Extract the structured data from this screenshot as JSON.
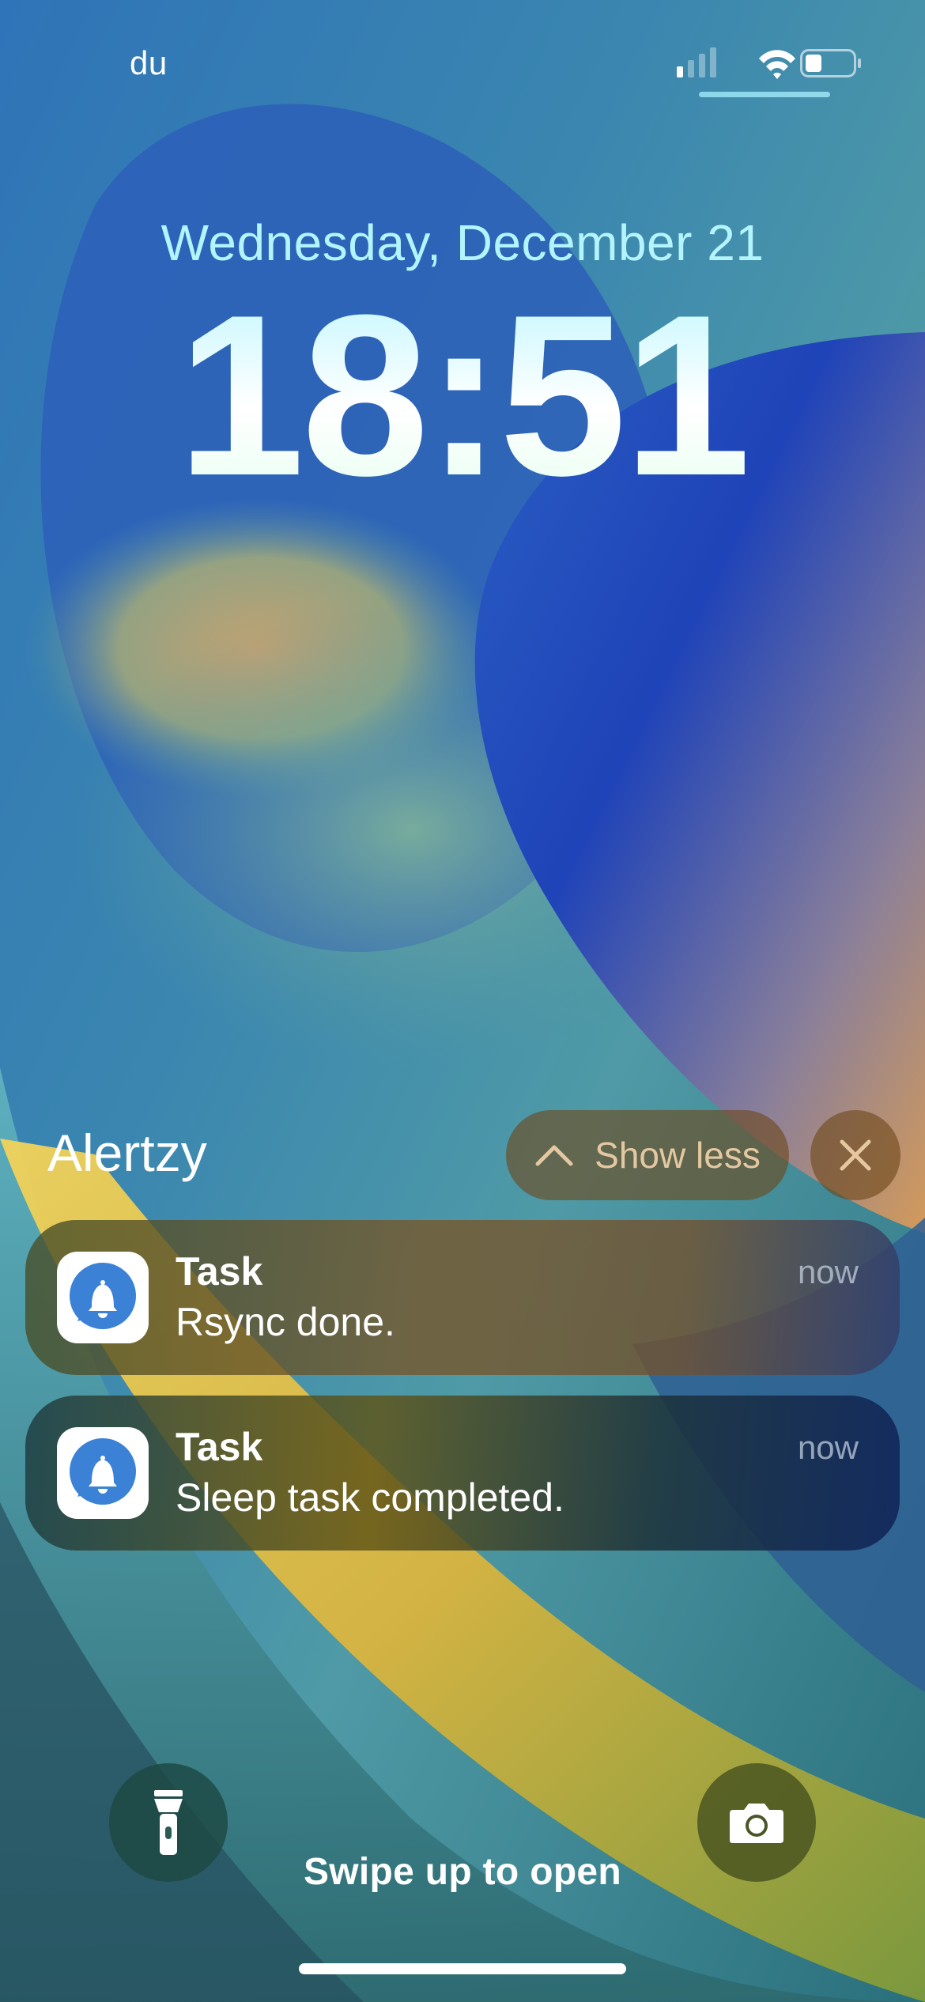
{
  "status_bar": {
    "carrier": "du",
    "signal_bars_active": 1,
    "signal_bars_total": 4,
    "wifi": "wifi-icon",
    "battery_level": 0.3
  },
  "lock_screen": {
    "date": "Wednesday, December 21",
    "time": "18:51"
  },
  "notification_group": {
    "app_name": "Alertzy",
    "show_less_label": "Show less",
    "close_icon": "close-icon",
    "notifications": [
      {
        "title": "Task",
        "body": "Rsync done.",
        "time": "now",
        "icon": "bell-chat-icon"
      },
      {
        "title": "Task",
        "body": "Sleep task completed.",
        "time": "now",
        "icon": "bell-chat-icon"
      }
    ]
  },
  "bottom": {
    "flashlight_icon": "flashlight-icon",
    "camera_icon": "camera-icon",
    "swipe_hint": "Swipe up to open"
  },
  "colors": {
    "date_text": "#b3f4ff",
    "app_icon_blue": "#2f7fd6"
  }
}
